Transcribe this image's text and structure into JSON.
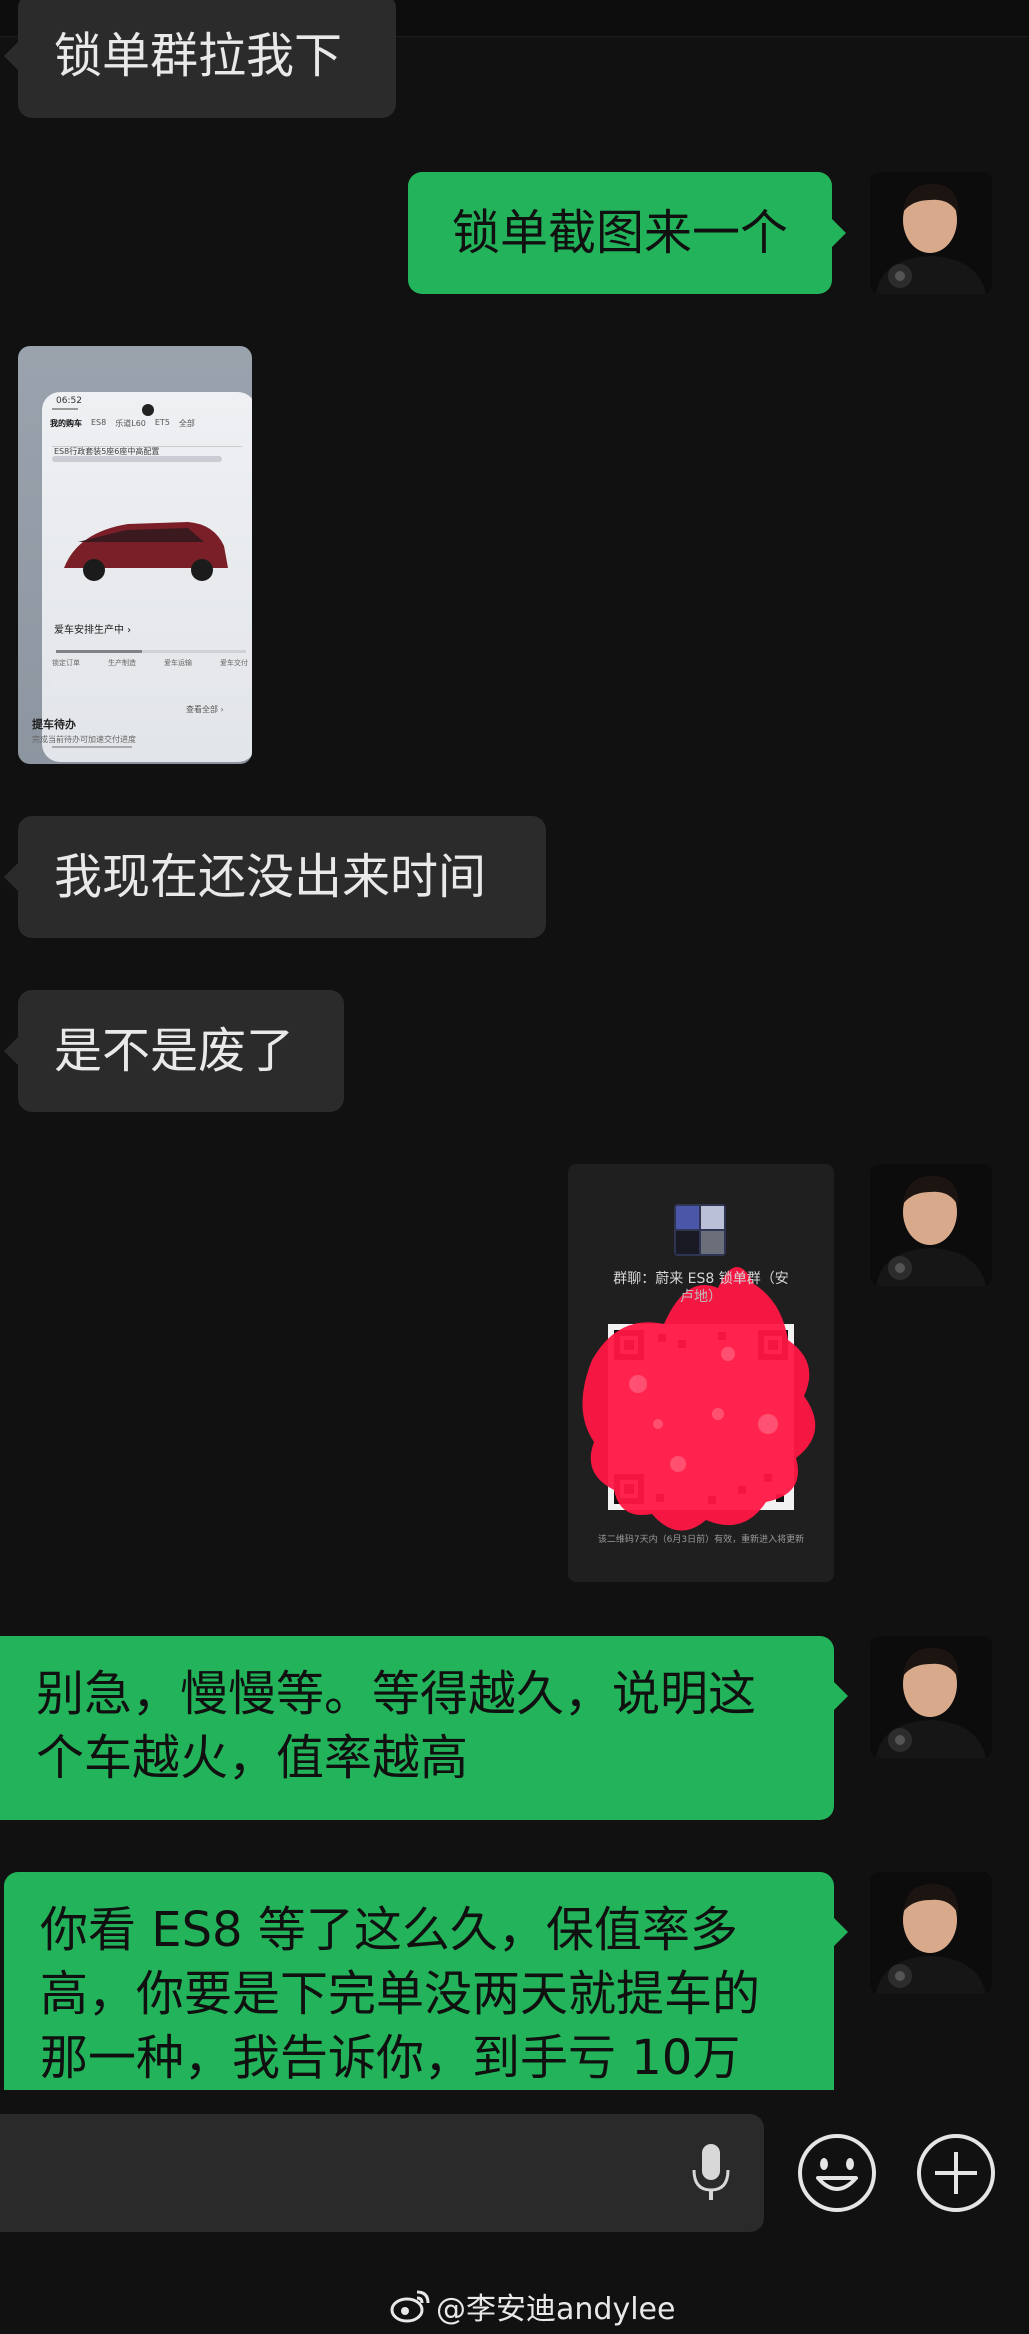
{
  "messages": [
    {
      "id": "m1",
      "side": "in",
      "text": "锁单群拉我下"
    },
    {
      "id": "m2",
      "side": "out",
      "text": "锁单截图来一个"
    },
    {
      "id": "m3",
      "side": "in",
      "type": "image"
    },
    {
      "id": "m4",
      "side": "in",
      "text": "我现在还没出来时间"
    },
    {
      "id": "m5",
      "side": "in",
      "text": "是不是废了"
    },
    {
      "id": "m6",
      "side": "out",
      "type": "image"
    },
    {
      "id": "m7",
      "side": "out",
      "lines": [
        "别急，慢慢等。等得越久，说明这",
        "个车越火，值率越高"
      ]
    },
    {
      "id": "m8",
      "side": "out",
      "lines": [
        "你看 ES8 等了这么久，保值率多",
        "高，你要是下完单没两天就提车的",
        "那一种，我告诉你，到手亏 10万"
      ]
    }
  ],
  "screenshot_image": {
    "status_time": "06:52",
    "tabs": [
      "我的购车",
      "ES8",
      "乐道L60",
      "ET5",
      "全部"
    ],
    "banner": "ES8行政套装5座6座中高配置",
    "progress_title": "爱车安排生产中 ›",
    "steps": [
      "锁定订单",
      "生产制造",
      "爱车运输",
      "爱车交付"
    ],
    "view_all": "查看全部 ›",
    "todo_title": "提车待办",
    "todo_sub": "完成当前待办可加速交付进度"
  },
  "qr_image": {
    "title": "群聊：蔚来 ES8 锁单群（安",
    "title_cont": "卢地）",
    "footer": "该二维码7天内（6月3日前）有效，重新进入将更新"
  },
  "input_bar": {
    "voice_icon": "microphone-icon",
    "emoji_icon": "emoji-icon",
    "plus_icon": "plus-icon"
  },
  "watermark": {
    "text": "@李安迪andylee",
    "icon": "weibo-icon"
  },
  "colors": {
    "background": "#111111",
    "bubble_in": "#2b2b2b",
    "bubble_out": "#23b35a",
    "qr_redaction": "#ff1744"
  }
}
